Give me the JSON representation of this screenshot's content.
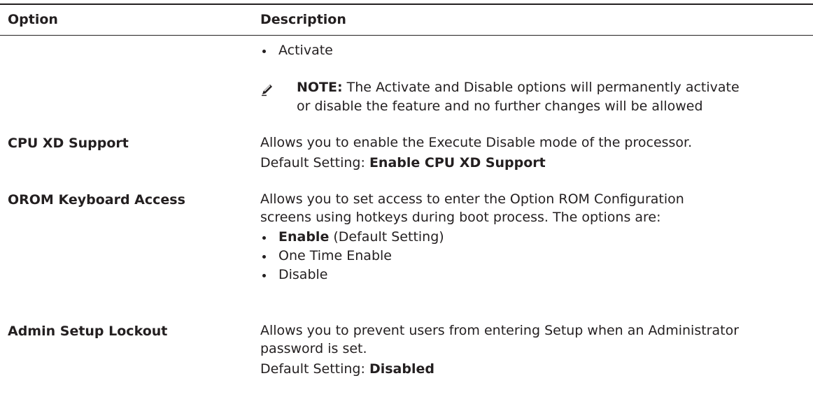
{
  "header": {
    "option_label": "Option",
    "description_label": "Description"
  },
  "rows": {
    "activate_continuation": {
      "bullet": "Activate",
      "note": {
        "icon": "pencil-note-icon",
        "label": "NOTE:",
        "line1": " The Activate and Disable options will permanently activate",
        "line2": "or disable the feature and no further changes will be allowed"
      }
    },
    "cpu_xd": {
      "option": "CPU XD Support",
      "line1": "Allows you to enable the Execute Disable mode of the processor.",
      "default_prefix": "Default Setting: ",
      "default_value": "Enable CPU XD Support"
    },
    "orom": {
      "option": "OROM Keyboard Access",
      "line1": "Allows you to set access to enter the Option ROM Configuration",
      "line2": "screens using hotkeys during boot process. The options are:",
      "bullets": {
        "b0_bold": "Enable",
        "b0_rest": " (Default Setting)",
        "b1": "One Time Enable",
        "b2": "Disable"
      }
    },
    "admin_lockout": {
      "option": "Admin Setup Lockout",
      "line1": "Allows you to prevent users from entering Setup when an Administrator",
      "line2": "password is set.",
      "default_prefix": "Default Setting: ",
      "default_value": "Disabled"
    }
  },
  "colors": {
    "text": "#231f20",
    "background": "#ffffff"
  }
}
